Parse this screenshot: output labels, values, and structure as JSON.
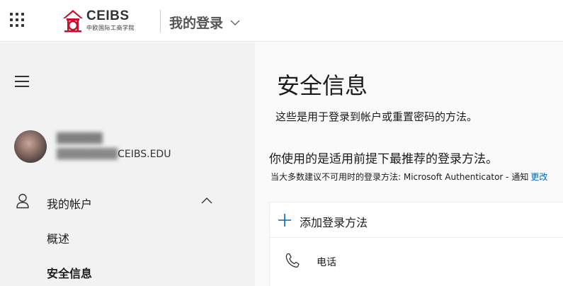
{
  "header": {
    "brand_name": "CEIBS",
    "brand_sub": "中欧国际工商学院",
    "app_title": "我的登录",
    "brand_color": "#c8102e"
  },
  "sidebar": {
    "user": {
      "name": "██████",
      "email_masked": "████████",
      "email_domain": "CEIBS.EDU"
    },
    "nav": {
      "account_label": "我的帐户",
      "overview_label": "概述",
      "security_label": "安全信息"
    }
  },
  "main": {
    "title": "安全信息",
    "description": "这些是用于登录到帐户或重置密码的方法。",
    "default_heading": "你使用的是适用前提下最推荐的登录方法。",
    "default_method_text": "当大多数建议不可用时的登录方法: Microsoft Authenticator - 通知",
    "change_link": "更改",
    "add_method_label": "添加登录方法",
    "methods": [
      {
        "icon": "phone-icon",
        "label": "电话"
      }
    ],
    "accent_color": "#0067b8"
  }
}
